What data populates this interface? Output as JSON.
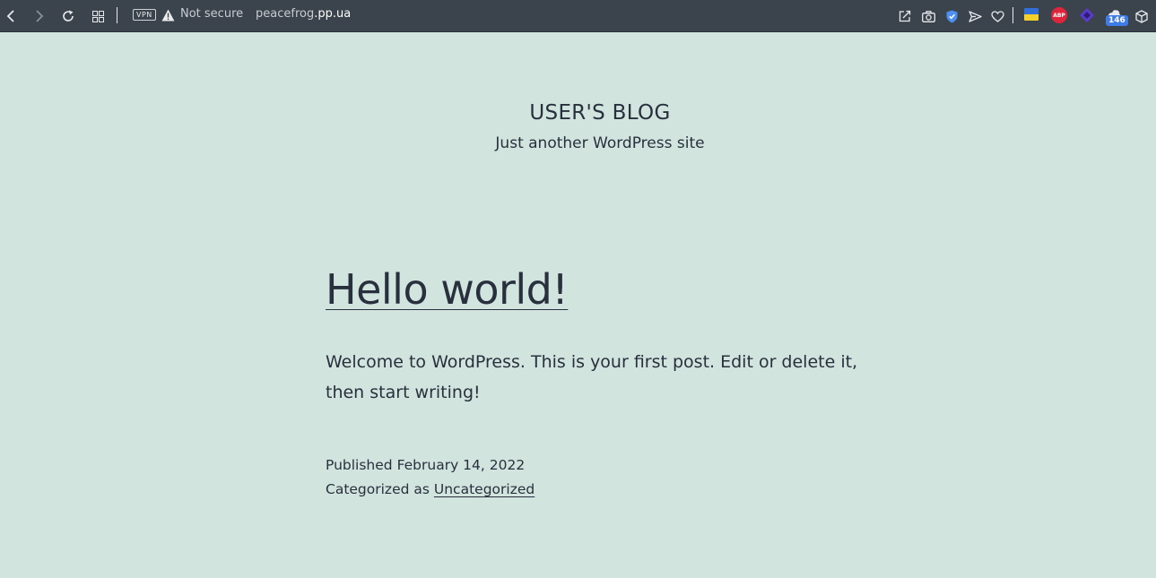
{
  "browser": {
    "vpn_label": "VPN",
    "security_text": "Not secure",
    "url_domain": "peacefrog",
    "url_tld": ".pp.ua",
    "extension_abp_label": "ABP",
    "extension_badge_count": "146",
    "icons": [
      "back-icon",
      "forward-icon",
      "reload-icon",
      "tab-grid-icon",
      "warning-icon",
      "share-icon",
      "camera-icon",
      "shield-icon",
      "send-icon",
      "heart-icon",
      "ukraine-flag-icon",
      "adblock-icon",
      "diamond-extension-icon",
      "cloud-extension-icon",
      "cube-icon"
    ]
  },
  "site": {
    "title": "USER'S BLOG",
    "description": "Just another WordPress site"
  },
  "post": {
    "title": "Hello world!",
    "body": "Welcome to WordPress. This is your first post. Edit or delete it, then start writing!",
    "published_label": "Published",
    "published_date": "February 14, 2022",
    "category_label": "Categorized as",
    "category": "Uncategorized"
  },
  "colors": {
    "page_background": "#d1e4dd",
    "text": "#28303d",
    "toolbar": "#3b434d"
  }
}
